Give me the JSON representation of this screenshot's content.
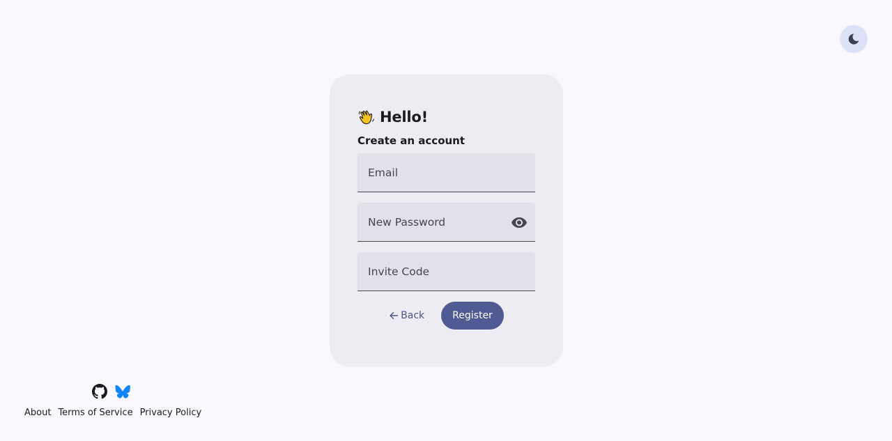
{
  "header": {
    "theme_toggle_icon": "moon-icon"
  },
  "card": {
    "greeting_icon": "waving-hand-icon",
    "title": "Hello!",
    "subtitle": "Create an account",
    "fields": {
      "email": {
        "placeholder": "Email",
        "value": ""
      },
      "password": {
        "placeholder": "New Password",
        "value": "",
        "toggle_icon": "eye-icon"
      },
      "invite": {
        "placeholder": "Invite Code",
        "value": ""
      }
    },
    "back_label": "Back",
    "register_label": "Register"
  },
  "footer": {
    "social_icons": [
      "github-icon",
      "bluesky-icon"
    ],
    "links": {
      "about": "About",
      "terms": "Terms of Service",
      "privacy": "Privacy Policy"
    }
  },
  "colors": {
    "background": "#faf8ff",
    "card": "#edecf3",
    "field": "#e2e1e9",
    "primary": "#4f5b92",
    "toggle_bg": "#dde1f8",
    "bluesky": "#1185fe"
  }
}
